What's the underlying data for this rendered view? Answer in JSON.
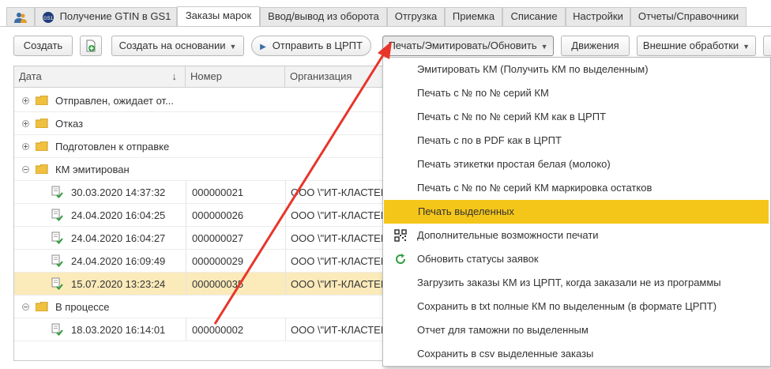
{
  "tabs": [
    {
      "label": ""
    },
    {
      "label": "Получение GTIN в GS1"
    },
    {
      "label": "Заказы марок"
    },
    {
      "label": "Ввод/вывод из оборота"
    },
    {
      "label": "Отгрузка"
    },
    {
      "label": "Приемка"
    },
    {
      "label": "Списание"
    },
    {
      "label": "Настройки"
    },
    {
      "label": "Отчеты/Справочники"
    }
  ],
  "toolbar": {
    "create": "Создать",
    "create_based": "Создать на основании",
    "send": "Отправить в ЦРПТ",
    "print": "Печать/Эмитировать/Обновить",
    "movements": "Движения",
    "external": "Внешние обработки"
  },
  "table": {
    "columns": [
      "Дата",
      "Номер",
      "Организация"
    ],
    "sort_indicator": "↓",
    "groups": [
      {
        "label": "Отправлен, ожидает от...",
        "expanded": false
      },
      {
        "label": "Отказ",
        "expanded": false
      },
      {
        "label": "Подготовлен к отправке",
        "expanded": false
      },
      {
        "label": "КМ эмитирован",
        "expanded": true
      },
      {
        "label": "В процессе",
        "expanded": true
      }
    ],
    "rows": [
      {
        "date": "30.03.2020 14:37:32",
        "number": "000000021",
        "org": "ООО \\\"ИТ-КЛАСТЕР"
      },
      {
        "date": "24.04.2020 16:04:25",
        "number": "000000026",
        "org": "ООО \\\"ИТ-КЛАСТЕР"
      },
      {
        "date": "24.04.2020 16:04:27",
        "number": "000000027",
        "org": "ООО \\\"ИТ-КЛАСТЕР"
      },
      {
        "date": "24.04.2020 16:09:49",
        "number": "000000029",
        "org": "ООО \\\"ИТ-КЛАСТЕР"
      },
      {
        "date": "15.07.2020 13:23:24",
        "number": "000000035",
        "org": "ООО \\\"ИТ-КЛАСТЕР"
      },
      {
        "date": "18.03.2020 16:14:01",
        "number": "000000002",
        "org": "ООО \\\"ИТ-КЛАСТЕР"
      }
    ]
  },
  "menu": {
    "items": [
      {
        "label": "Эмитировать КМ (Получить КМ по выделенным)",
        "icon": ""
      },
      {
        "label": "Печать с № по № серий КМ",
        "icon": ""
      },
      {
        "label": "Печать с № по № серий КМ как в ЦРПТ",
        "icon": ""
      },
      {
        "label": "Печать с по в PDF как в ЦРПТ",
        "icon": ""
      },
      {
        "label": "Печать этикетки простая белая (молоко)",
        "icon": ""
      },
      {
        "label": "Печать с № по № серий КМ маркировка остатков",
        "icon": ""
      },
      {
        "label": "Печать выделенных",
        "icon": ""
      },
      {
        "label": "Дополнительные возможности печати",
        "icon": "qr-code-icon"
      },
      {
        "label": "Обновить статусы заявок",
        "icon": "refresh-icon"
      },
      {
        "label": "Загрузить заказы КМ из ЦРПТ, когда заказали не из программы",
        "icon": ""
      },
      {
        "label": "Сохранить в txt полные КМ по выделенным (в формате ЦРПТ)",
        "icon": ""
      },
      {
        "label": "Отчет для таможни по выделенным",
        "icon": ""
      },
      {
        "label": "Сохранить в csv выделенные заказы",
        "icon": ""
      }
    ],
    "highlighted_index": 6
  },
  "colors": {
    "highlight": "#f5c61a",
    "selected_row": "#fbeaba",
    "annotation_arrow": "#e8352a"
  }
}
